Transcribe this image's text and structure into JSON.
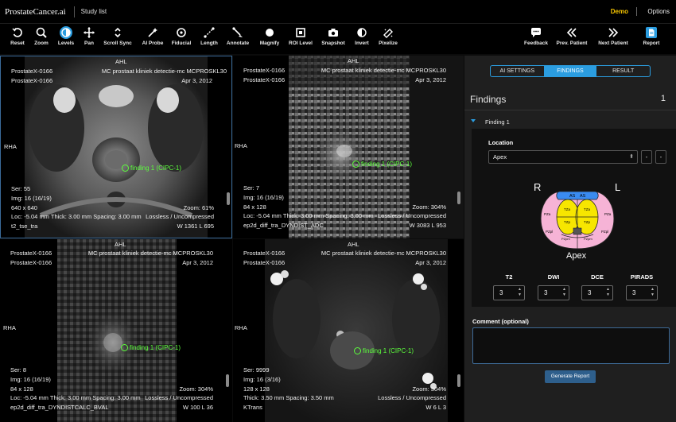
{
  "app": {
    "brand": "ProstateCancer.ai",
    "study_list": "Study list",
    "user": "Demo",
    "options": "Options"
  },
  "toolbar": {
    "left": [
      {
        "label": "Reset",
        "icon": "reset-icon"
      },
      {
        "label": "Zoom",
        "icon": "zoom-icon"
      },
      {
        "label": "Levels",
        "icon": "levels-icon"
      },
      {
        "label": "Pan",
        "icon": "pan-icon"
      },
      {
        "label": "Scroll Sync",
        "icon": "scroll-sync-icon"
      },
      {
        "label": "AI Probe",
        "icon": "ai-probe-icon"
      },
      {
        "label": "Fiducial",
        "icon": "fiducial-icon"
      },
      {
        "label": "Length",
        "icon": "length-icon"
      },
      {
        "label": "Annotate",
        "icon": "annotate-icon"
      },
      {
        "label": "Magnify",
        "icon": "magnify-icon"
      },
      {
        "label": "ROI Level",
        "icon": "roi-level-icon"
      },
      {
        "label": "Snapshot",
        "icon": "snapshot-icon"
      },
      {
        "label": "Invert",
        "icon": "invert-icon"
      },
      {
        "label": "Pixelize",
        "icon": "pixelize-icon"
      }
    ],
    "right": [
      {
        "label": "Feedback",
        "icon": "feedback-icon"
      },
      {
        "label": "Prev. Patient",
        "icon": "prev-patient-icon"
      },
      {
        "label": "Next Patient",
        "icon": "next-patient-icon"
      },
      {
        "label": "Report",
        "icon": "report-icon"
      }
    ]
  },
  "viewports": [
    {
      "orient_top": "AHL",
      "orient_left": "RHA",
      "patient1": "ProstateX-0166",
      "patient2": "ProstateX-0166",
      "study": "MC prostaat kliniek detectie-mc MCPROSKL30",
      "date": "Apr 3, 2012",
      "ser": "Ser: 55",
      "img": "Img: 16 (16/19)",
      "size": "640 x 640",
      "loc": "Loc: -5.04 mm Thick: 3.00 mm Spacing: 3.00 mm",
      "zoom": "Zoom: 61%",
      "compression": "Lossless / Uncompressed",
      "series": "t2_tse_tra",
      "wl": "W 1361 L 695",
      "finding": "finding 1 (CIPC-1)"
    },
    {
      "orient_top": "AHL",
      "orient_left": "RHA",
      "patient1": "ProstateX-0166",
      "patient2": "ProstateX-0166",
      "study": "MC prostaat kliniek detectie-mc MCPROSKL30",
      "date": "Apr 3, 2012",
      "ser": "Ser: 7",
      "img": "Img: 16 (16/19)",
      "size": "84 x 128",
      "loc": "Loc: -5.04 mm Thick: 3.00 mm Spacing: 3.00 mm",
      "zoom": "Zoom: 304%",
      "compression": "Lossless / Uncompressed",
      "series": "ep2d_diff_tra_DYNDIST_ADC",
      "wl": "W 3083 L 953",
      "finding": "finding 1 (CIPC-1)"
    },
    {
      "orient_top": "AHL",
      "orient_left": "RHA",
      "patient1": "ProstateX-0166",
      "patient2": "ProstateX-0166",
      "study": "MC prostaat kliniek detectie-mc MCPROSKL30",
      "date": "Apr 3, 2012",
      "ser": "Ser: 8",
      "img": "Img: 16 (16/19)",
      "size": "84 x 128",
      "loc": "Loc: -5.04 mm Thick: 3.00 mm Spacing: 3.00 mm",
      "zoom": "Zoom: 304%",
      "compression": "Lossless / Uncompressed",
      "series": "ep2d_diff_tra_DYNDISTCALC_BVAL",
      "wl": "W 100 L 36",
      "finding": "finding 1 (CIPC-1)"
    },
    {
      "orient_top": "AHL",
      "orient_left": "RHA",
      "patient1": "ProstateX-0166",
      "patient2": "ProstateX-0166",
      "study": "MC prostaat kliniek detectie-mc MCPROSKL30",
      "date": "Apr 3, 2012",
      "ser": "Ser: 9999",
      "img": "Img: 16 (3/16)",
      "size": "128 x 128",
      "loc": "Thick: 3.50 mm Spacing: 3.50 mm",
      "zoom": "Zoom: 304%",
      "compression": "Lossless / Uncompressed",
      "series": "KTrans",
      "wl": "W 6 L 3",
      "finding": "finding 1 (CIPC-1)"
    }
  ],
  "panel": {
    "tabs": [
      "AI SETTINGS",
      "FINDINGS",
      "RESULT"
    ],
    "active_tab": "FINDINGS",
    "title": "Findings",
    "count": "1",
    "finding_label": "Finding 1",
    "location_label": "Location",
    "location_value": "Apex",
    "minus1": "-",
    "minus2": "-",
    "diagram": {
      "left": "R",
      "right": "L",
      "caption": "Apex",
      "zones": [
        "AS",
        "AS",
        "TZa",
        "TZa",
        "TZp",
        "TZp",
        "PZa",
        "PZa",
        "PZpl",
        "PZpl",
        "PZpm",
        "PZpm"
      ]
    },
    "scores": [
      {
        "label": "T2",
        "value": "3"
      },
      {
        "label": "DWI",
        "value": "3"
      },
      {
        "label": "DCE",
        "value": "3"
      },
      {
        "label": "PIRADS",
        "value": "3"
      }
    ],
    "comment_label": "Comment (optional)",
    "comment_value": "",
    "generate_label": "Generate Report"
  },
  "colors": {
    "accent": "#2b9de0",
    "finding": "#5cff3c",
    "user": "#f5c400",
    "zone_as": "#3a8bf0",
    "zone_tz": "#f7e600",
    "zone_pz": "#f6b3d6"
  }
}
